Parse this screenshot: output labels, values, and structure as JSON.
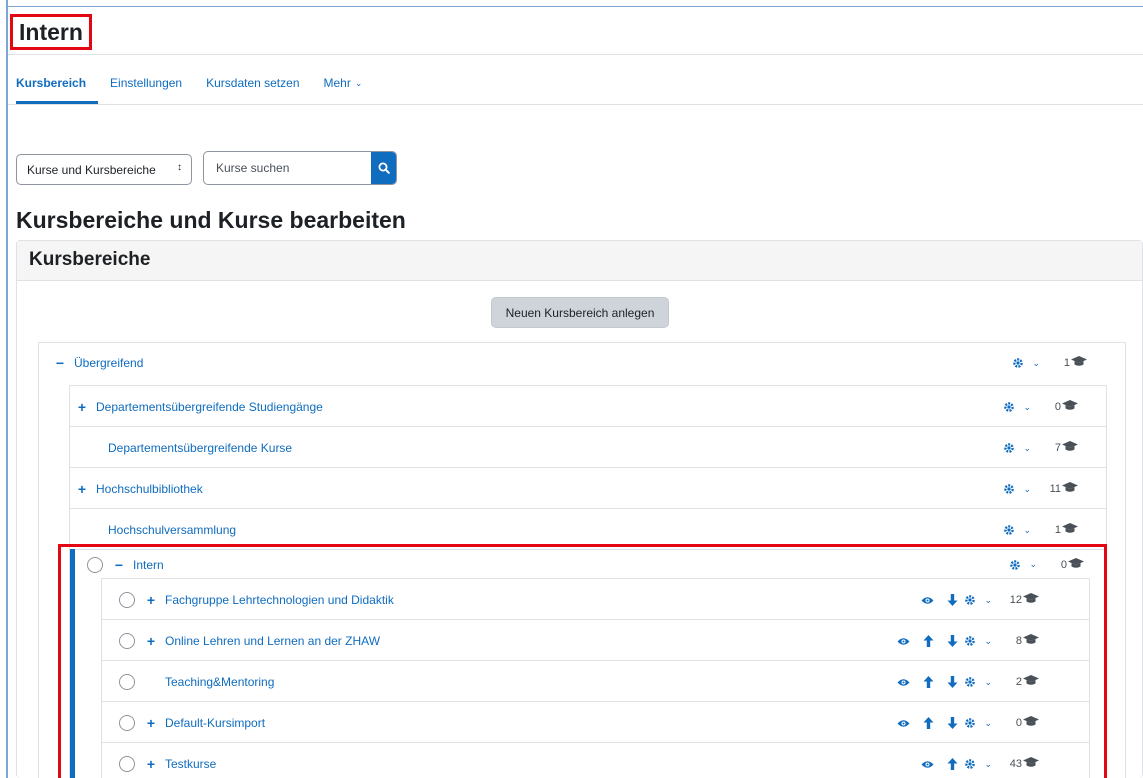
{
  "page": {
    "title": "Intern"
  },
  "nav": {
    "tabs": [
      {
        "label": "Kursbereich",
        "active": true
      },
      {
        "label": "Einstellungen"
      },
      {
        "label": "Kursdaten setzen"
      },
      {
        "label": "Mehr"
      }
    ]
  },
  "filter": {
    "select_value": "Kurse und Kursbereiche",
    "search_placeholder": "Kurse suchen"
  },
  "main": {
    "heading": "Kursbereiche und Kurse bearbeiten",
    "card_title": "Kursbereiche",
    "new_button": "Neuen Kursbereich anlegen"
  },
  "tree": {
    "root": {
      "label": "Übergreifend",
      "count": "1",
      "expanded": true
    },
    "children": [
      {
        "label": "Departementsübergreifende Studiengänge",
        "count": "0",
        "expandable": true
      },
      {
        "label": "Departementsübergreifende Kurse",
        "count": "7",
        "expandable": false
      },
      {
        "label": "Hochschulbibliothek",
        "count": "11",
        "expandable": true
      },
      {
        "label": "Hochschulversammlung",
        "count": "1",
        "expandable": false
      }
    ],
    "intern": {
      "label": "Intern",
      "count": "0",
      "expanded": true
    },
    "intern_children": [
      {
        "label": "Fachgruppe Lehrtechnologien und Didaktik",
        "count": "12",
        "expandable": true,
        "up": false,
        "down": true
      },
      {
        "label": "Online Lehren und Lernen an der ZHAW",
        "count": "8",
        "expandable": true,
        "up": true,
        "down": true
      },
      {
        "label": "Teaching&Mentoring",
        "count": "2",
        "expandable": false,
        "up": true,
        "down": true
      },
      {
        "label": "Default-Kursimport",
        "count": "0",
        "expandable": true,
        "up": true,
        "down": true
      },
      {
        "label": "Testkurse",
        "count": "43",
        "expandable": true,
        "up": true,
        "down": false
      }
    ]
  },
  "colors": {
    "link": "#0f6cbf",
    "highlight": "#e30613",
    "text": "#1d2125"
  }
}
